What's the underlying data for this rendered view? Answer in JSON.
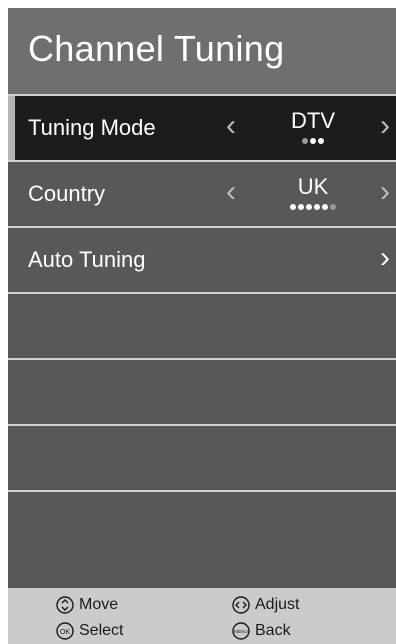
{
  "title": "Channel Tuning",
  "rows": [
    {
      "label": "Tuning Mode",
      "value": "DTV",
      "dots_total": 3,
      "dots_active": 2,
      "selected": true
    },
    {
      "label": "Country",
      "value": "UK",
      "dots_total": 6,
      "dots_active": 5,
      "selected": false
    },
    {
      "label": "Auto Tuning",
      "value": "",
      "selected": false
    }
  ],
  "arrows": {
    "left": "‹",
    "right": "›"
  },
  "footer": {
    "move": {
      "label": "Move",
      "icon": "up-down-icon"
    },
    "adjust": {
      "label": "Adjust",
      "icon": "left-right-icon"
    },
    "select": {
      "label": "Select",
      "icon": "ok-icon",
      "icon_text": "OK"
    },
    "back": {
      "label": "Back",
      "icon": "menu-icon",
      "icon_text": "MENU"
    }
  },
  "colors": {
    "title_bg": "#6f6f6f",
    "row_bg": "#585858",
    "selected_bg": "#1c1c1c",
    "footer_bg": "#cbcbcb"
  }
}
